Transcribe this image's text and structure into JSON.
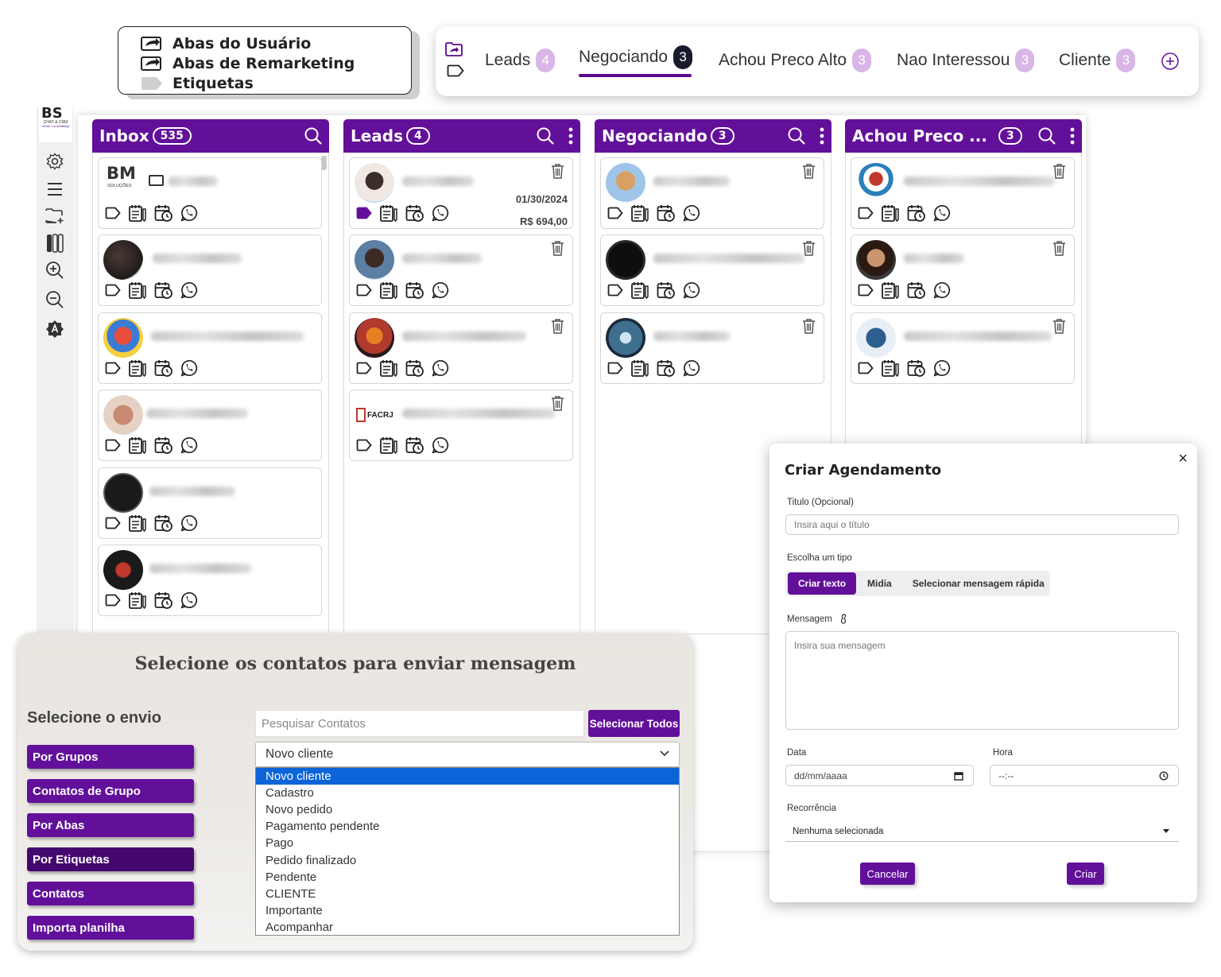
{
  "legend": {
    "items": [
      {
        "label": "Abas do Usuário",
        "icon": "share-arrow-icon"
      },
      {
        "label": "Abas de Remarketing",
        "icon": "share-arrow-icon"
      },
      {
        "label": "Etiquetas",
        "icon": "tag-icon"
      }
    ]
  },
  "tabbar": {
    "tabs": [
      {
        "label": "Leads",
        "count": "4"
      },
      {
        "label": "Negociando",
        "count": "3"
      },
      {
        "label": "Achou Preco Alto",
        "count": "3"
      },
      {
        "label": "Nao Interessou",
        "count": "3"
      },
      {
        "label": "Cliente",
        "count": "3"
      }
    ],
    "active_tab": "Negociando"
  },
  "sidebar": {
    "logo_letters": "BS",
    "logo_text": "CHAT & CRM",
    "logo_subtext": "Venda + no WhatsApp"
  },
  "columns": [
    {
      "title": "Inbox",
      "count": "535"
    },
    {
      "title": "Leads",
      "count": "4",
      "cards": [
        {
          "date": "01/30/2024",
          "price": "R$ 694,00"
        }
      ]
    },
    {
      "title": "Negociando",
      "count": "3"
    },
    {
      "title": "Achou Preco ...",
      "count": "3"
    }
  ],
  "avatars": {
    "inbox_1": "BM",
    "inbox_1_sub": "SOLUÇÕES",
    "leads_4": "FACRJ"
  },
  "send_panel": {
    "title": "Selecione os contatos para enviar mensagem",
    "subtitle": "Selecione o envio",
    "buttons": [
      "Por Grupos",
      "Contatos de Grupo",
      "Por Abas",
      "Por Etiquetas",
      "Contatos",
      "Importa planilha"
    ],
    "search_placeholder": "Pesquisar Contatos",
    "select_all_label": "Selecionar Todos",
    "selected_option": "Novo cliente",
    "options": [
      "Novo cliente",
      "Cadastro",
      "Novo pedido",
      "Pagamento pendente",
      "Pago",
      "Pedido finalizado",
      "Pendente",
      "CLIENTE",
      "Importante",
      "Acompanhar"
    ]
  },
  "modal": {
    "title": "Criar Agendamento",
    "close": "×",
    "title_label": "Titulo (Opcional)",
    "title_placeholder": "Insira aqui o título",
    "type_label": "Escolha um tipo",
    "type_options": [
      "Criar texto",
      "Midia",
      "Selecionar mensagem rápida"
    ],
    "message_label": "Mensagem",
    "message_placeholder": "Insira sua mensagem",
    "date_label": "Data",
    "date_value": "dd/mm/aaaa",
    "time_label": "Hora",
    "time_value": "--:--",
    "recurrence_label": "Recorrência",
    "recurrence_value": "Nenhuma selecionada",
    "cancel_label": "Cancelar",
    "create_label": "Criar"
  },
  "colors": {
    "primary": "#62109a",
    "primary_dark": "#44076e",
    "badge": "#d9b6e6",
    "select_highlight": "#0b65d8"
  }
}
